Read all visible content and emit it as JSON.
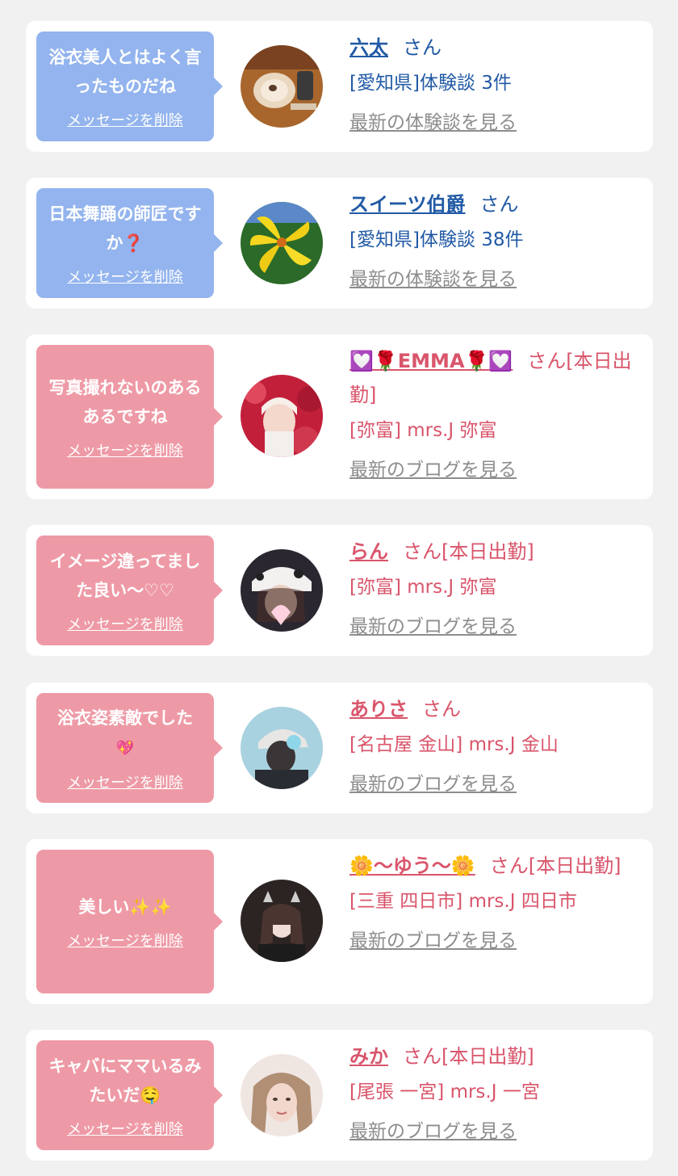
{
  "cards": [
    {
      "message": "浴衣美人とはよく言ったものだね",
      "delete_label": "メッセージを削除",
      "name": "六太",
      "honorific": "さん",
      "meta": "[愛知県]体験談 3件",
      "more_link": "最新の体験談を見る"
    },
    {
      "message": "日本舞踊の師匠ですか",
      "message_emoji": "❓",
      "delete_label": "メッセージを削除",
      "name": "スイーツ伯爵",
      "honorific": "さん",
      "meta": "[愛知県]体験談 38件",
      "more_link": "最新の体験談を見る"
    },
    {
      "message": "写真撮れないのあるあるですね",
      "delete_label": "メッセージを削除",
      "name": "EMMA",
      "name_emoji_outer": "💟",
      "name_emoji_inner": "🌹",
      "honorific": "さん[本日出勤]",
      "meta": "[弥富] mrs.J 弥富",
      "more_link": "最新のブログを見る"
    },
    {
      "message": "イメージ違ってました良い〜♡♡",
      "delete_label": "メッセージを削除",
      "name": "らん",
      "honorific": "さん[本日出勤]",
      "meta": "[弥富] mrs.J 弥富",
      "more_link": "最新のブログを見る"
    },
    {
      "message": "浴衣姿素敵でした",
      "message_emoji": "💖",
      "delete_label": "メッセージを削除",
      "name": "ありさ",
      "honorific": "さん",
      "meta": "[名古屋 金山] mrs.J 金山",
      "more_link": "最新のブログを見る"
    },
    {
      "message": "美しい",
      "message_emoji": "✨✨",
      "delete_label": "メッセージを削除",
      "name": "〜ゆう〜",
      "name_emoji": "🌼",
      "honorific": "さん[本日出勤]",
      "meta": "[三重 四日市] mrs.J 四日市",
      "more_link": "最新のブログを見る"
    },
    {
      "message": "キャバにママいるみたいだ",
      "message_emoji": "🤤",
      "delete_label": "メッセージを削除",
      "name": "みか",
      "honorific": "さん[本日出勤]",
      "meta": "[尾張 一宮] mrs.J 一宮",
      "more_link": "最新のブログを見る"
    }
  ],
  "colors": {
    "background": "#f1f1f1",
    "card": "#ffffff",
    "bubble_blue": "#93b4ee",
    "bubble_pink": "#ee9aa6",
    "text_blue": "#225aa5",
    "text_pink": "#d9556b",
    "link_gray": "#8d8d8d"
  }
}
